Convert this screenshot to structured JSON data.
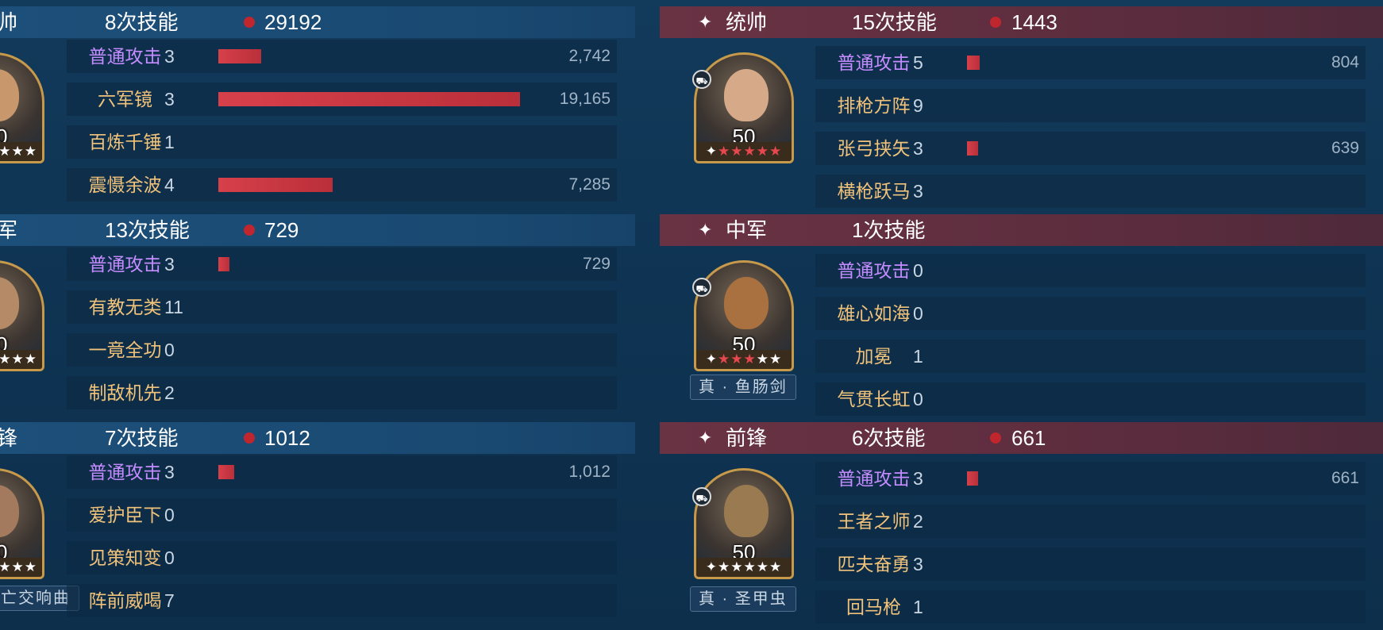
{
  "colors": {
    "bar": "#d7404a",
    "header_left": "#1c4f7a",
    "header_right": "#6a3344",
    "skill_orange": "#f0c27a",
    "skill_purple": "#c48cff"
  },
  "left": {
    "teams": [
      {
        "position": "帅",
        "skill_count": "8次技能",
        "total": "29192",
        "level": "0",
        "skills": [
          {
            "name": "普通攻击",
            "count": "3",
            "damage": "2,742",
            "value": 2742
          },
          {
            "name": "六军镜",
            "count": "3",
            "damage": "19,165",
            "value": 19165
          },
          {
            "name": "百炼千锤",
            "count": "1",
            "damage": "",
            "value": 0
          },
          {
            "name": "震慑余波",
            "count": "4",
            "damage": "7,285",
            "value": 7285
          }
        ]
      },
      {
        "position": "军",
        "skill_count": "13次技能",
        "total": "729",
        "level": "0",
        "skills": [
          {
            "name": "普通攻击",
            "count": "3",
            "damage": "729",
            "value": 729
          },
          {
            "name": "有教无类",
            "count": "11",
            "damage": "",
            "value": 0
          },
          {
            "name": "一竟全功",
            "count": "0",
            "damage": "",
            "value": 0
          },
          {
            "name": "制敌机先",
            "count": "2",
            "damage": "",
            "value": 0
          }
        ]
      },
      {
        "position": "锋",
        "skill_count": "7次技能",
        "total": "1012",
        "level": "0",
        "weapon": "亡交响曲",
        "skills": [
          {
            "name": "普通攻击",
            "count": "3",
            "damage": "1,012",
            "value": 1012
          },
          {
            "name": "爱护臣下",
            "count": "0",
            "damage": "",
            "value": 0
          },
          {
            "name": "见策知变",
            "count": "0",
            "damage": "",
            "value": 0
          },
          {
            "name": "阵前威喝",
            "count": "7",
            "damage": "",
            "value": 0
          }
        ]
      }
    ]
  },
  "right": {
    "teams": [
      {
        "position": "统帅",
        "skill_count": "15次技能",
        "total": "1443",
        "level": "50",
        "stars_red": 5,
        "skills": [
          {
            "name": "普通攻击",
            "count": "5",
            "damage": "804",
            "value": 804
          },
          {
            "name": "排枪方阵",
            "count": "9",
            "damage": "",
            "value": 0
          },
          {
            "name": "张弓挟矢",
            "count": "3",
            "damage": "639",
            "value": 639
          },
          {
            "name": "横枪跃马",
            "count": "3",
            "damage": "",
            "value": 0
          }
        ]
      },
      {
        "position": "中军",
        "skill_count": "1次技能",
        "total": "",
        "level": "50",
        "stars_red": 3,
        "weapon": "真 · 鱼肠剑",
        "skills": [
          {
            "name": "普通攻击",
            "count": "0",
            "damage": "",
            "value": 0
          },
          {
            "name": "雄心如海",
            "count": "0",
            "damage": "",
            "value": 0
          },
          {
            "name": "加冕",
            "count": "1",
            "damage": "",
            "value": 0
          },
          {
            "name": "气贯长虹",
            "count": "0",
            "damage": "",
            "value": 0
          }
        ]
      },
      {
        "position": "前锋",
        "skill_count": "6次技能",
        "total": "661",
        "level": "50",
        "stars_red": 0,
        "weapon": "真 · 圣甲虫",
        "skills": [
          {
            "name": "普通攻击",
            "count": "3",
            "damage": "661",
            "value": 661
          },
          {
            "name": "王者之师",
            "count": "2",
            "damage": "",
            "value": 0
          },
          {
            "name": "匹夫奋勇",
            "count": "3",
            "damage": "",
            "value": 0
          },
          {
            "name": "回马枪",
            "count": "1",
            "damage": "",
            "value": 0
          }
        ]
      }
    ]
  }
}
